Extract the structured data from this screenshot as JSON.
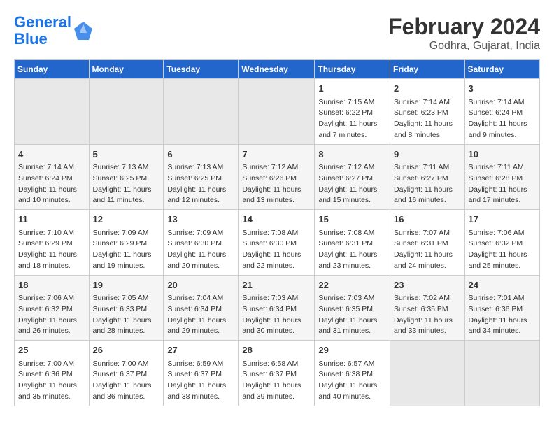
{
  "header": {
    "logo_line1": "General",
    "logo_line2": "Blue",
    "title": "February 2024",
    "subtitle": "Godhra, Gujarat, India"
  },
  "columns": [
    "Sunday",
    "Monday",
    "Tuesday",
    "Wednesday",
    "Thursday",
    "Friday",
    "Saturday"
  ],
  "weeks": [
    [
      {
        "num": "",
        "info": ""
      },
      {
        "num": "",
        "info": ""
      },
      {
        "num": "",
        "info": ""
      },
      {
        "num": "",
        "info": ""
      },
      {
        "num": "1",
        "info": "Sunrise: 7:15 AM\nSunset: 6:22 PM\nDaylight: 11 hours\nand 7 minutes."
      },
      {
        "num": "2",
        "info": "Sunrise: 7:14 AM\nSunset: 6:23 PM\nDaylight: 11 hours\nand 8 minutes."
      },
      {
        "num": "3",
        "info": "Sunrise: 7:14 AM\nSunset: 6:24 PM\nDaylight: 11 hours\nand 9 minutes."
      }
    ],
    [
      {
        "num": "4",
        "info": "Sunrise: 7:14 AM\nSunset: 6:24 PM\nDaylight: 11 hours\nand 10 minutes."
      },
      {
        "num": "5",
        "info": "Sunrise: 7:13 AM\nSunset: 6:25 PM\nDaylight: 11 hours\nand 11 minutes."
      },
      {
        "num": "6",
        "info": "Sunrise: 7:13 AM\nSunset: 6:25 PM\nDaylight: 11 hours\nand 12 minutes."
      },
      {
        "num": "7",
        "info": "Sunrise: 7:12 AM\nSunset: 6:26 PM\nDaylight: 11 hours\nand 13 minutes."
      },
      {
        "num": "8",
        "info": "Sunrise: 7:12 AM\nSunset: 6:27 PM\nDaylight: 11 hours\nand 15 minutes."
      },
      {
        "num": "9",
        "info": "Sunrise: 7:11 AM\nSunset: 6:27 PM\nDaylight: 11 hours\nand 16 minutes."
      },
      {
        "num": "10",
        "info": "Sunrise: 7:11 AM\nSunset: 6:28 PM\nDaylight: 11 hours\nand 17 minutes."
      }
    ],
    [
      {
        "num": "11",
        "info": "Sunrise: 7:10 AM\nSunset: 6:29 PM\nDaylight: 11 hours\nand 18 minutes."
      },
      {
        "num": "12",
        "info": "Sunrise: 7:09 AM\nSunset: 6:29 PM\nDaylight: 11 hours\nand 19 minutes."
      },
      {
        "num": "13",
        "info": "Sunrise: 7:09 AM\nSunset: 6:30 PM\nDaylight: 11 hours\nand 20 minutes."
      },
      {
        "num": "14",
        "info": "Sunrise: 7:08 AM\nSunset: 6:30 PM\nDaylight: 11 hours\nand 22 minutes."
      },
      {
        "num": "15",
        "info": "Sunrise: 7:08 AM\nSunset: 6:31 PM\nDaylight: 11 hours\nand 23 minutes."
      },
      {
        "num": "16",
        "info": "Sunrise: 7:07 AM\nSunset: 6:31 PM\nDaylight: 11 hours\nand 24 minutes."
      },
      {
        "num": "17",
        "info": "Sunrise: 7:06 AM\nSunset: 6:32 PM\nDaylight: 11 hours\nand 25 minutes."
      }
    ],
    [
      {
        "num": "18",
        "info": "Sunrise: 7:06 AM\nSunset: 6:32 PM\nDaylight: 11 hours\nand 26 minutes."
      },
      {
        "num": "19",
        "info": "Sunrise: 7:05 AM\nSunset: 6:33 PM\nDaylight: 11 hours\nand 28 minutes."
      },
      {
        "num": "20",
        "info": "Sunrise: 7:04 AM\nSunset: 6:34 PM\nDaylight: 11 hours\nand 29 minutes."
      },
      {
        "num": "21",
        "info": "Sunrise: 7:03 AM\nSunset: 6:34 PM\nDaylight: 11 hours\nand 30 minutes."
      },
      {
        "num": "22",
        "info": "Sunrise: 7:03 AM\nSunset: 6:35 PM\nDaylight: 11 hours\nand 31 minutes."
      },
      {
        "num": "23",
        "info": "Sunrise: 7:02 AM\nSunset: 6:35 PM\nDaylight: 11 hours\nand 33 minutes."
      },
      {
        "num": "24",
        "info": "Sunrise: 7:01 AM\nSunset: 6:36 PM\nDaylight: 11 hours\nand 34 minutes."
      }
    ],
    [
      {
        "num": "25",
        "info": "Sunrise: 7:00 AM\nSunset: 6:36 PM\nDaylight: 11 hours\nand 35 minutes."
      },
      {
        "num": "26",
        "info": "Sunrise: 7:00 AM\nSunset: 6:37 PM\nDaylight: 11 hours\nand 36 minutes."
      },
      {
        "num": "27",
        "info": "Sunrise: 6:59 AM\nSunset: 6:37 PM\nDaylight: 11 hours\nand 38 minutes."
      },
      {
        "num": "28",
        "info": "Sunrise: 6:58 AM\nSunset: 6:37 PM\nDaylight: 11 hours\nand 39 minutes."
      },
      {
        "num": "29",
        "info": "Sunrise: 6:57 AM\nSunset: 6:38 PM\nDaylight: 11 hours\nand 40 minutes."
      },
      {
        "num": "",
        "info": ""
      },
      {
        "num": "",
        "info": ""
      }
    ]
  ]
}
